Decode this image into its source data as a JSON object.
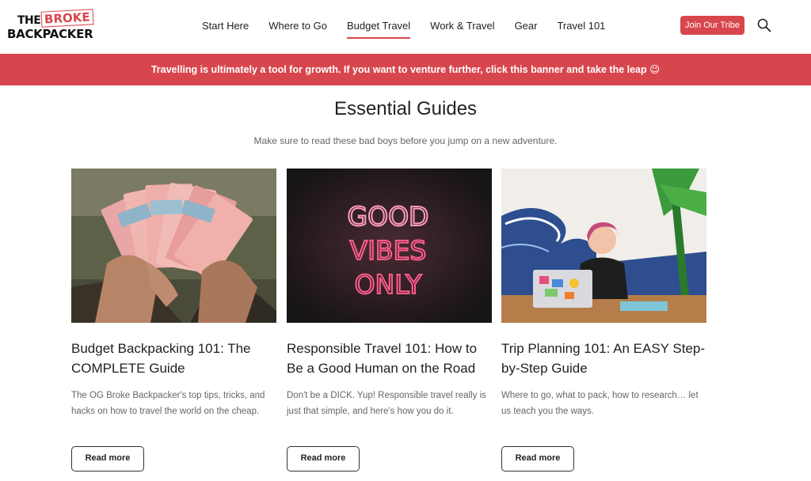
{
  "header": {
    "logo": {
      "line1": "THE",
      "line2": "BROKE",
      "line3": "BACKPACKER"
    },
    "nav": [
      {
        "label": "Start Here"
      },
      {
        "label": "Where to Go"
      },
      {
        "label": "Budget Travel",
        "active": true
      },
      {
        "label": "Work & Travel"
      },
      {
        "label": "Gear"
      },
      {
        "label": "Travel 101"
      }
    ],
    "cta_label": "Join Our Tribe",
    "search_icon": "search-icon"
  },
  "banner": {
    "text": "Travelling is ultimately a tool for growth. If you want to venture further, click this banner and take the leap 😉"
  },
  "section": {
    "title": "Essential Guides",
    "subtitle": "Make sure to read these bad boys before you jump on a new adventure."
  },
  "cards": [
    {
      "image": "hands-holding-euro-banknotes",
      "title": "Budget Backpacking 101: The COMPLETE Guide",
      "desc": "The OG Broke Backpacker's top tips, tricks, and hacks on how to travel the world on the cheap.",
      "button": "Read more"
    },
    {
      "image": "neon-sign",
      "neon": [
        "GOOD",
        "VIBES",
        "ONLY"
      ],
      "title": "Responsible Travel 101: How to Be a Good Human on the Road",
      "desc": "Don't be a DICK. Yup! Responsible travel really is just that simple, and here's how you do it.",
      "button": "Read more"
    },
    {
      "image": "woman-with-laptop-wave-mural",
      "title": "Trip Planning 101: An EASY Step-by-Step Guide",
      "desc": "Where to go, what to pack, how to research… let us teach you the ways.",
      "button": "Read more"
    }
  ],
  "colors": {
    "accent": "#d8464d",
    "text": "#222222",
    "muted": "#666666"
  }
}
